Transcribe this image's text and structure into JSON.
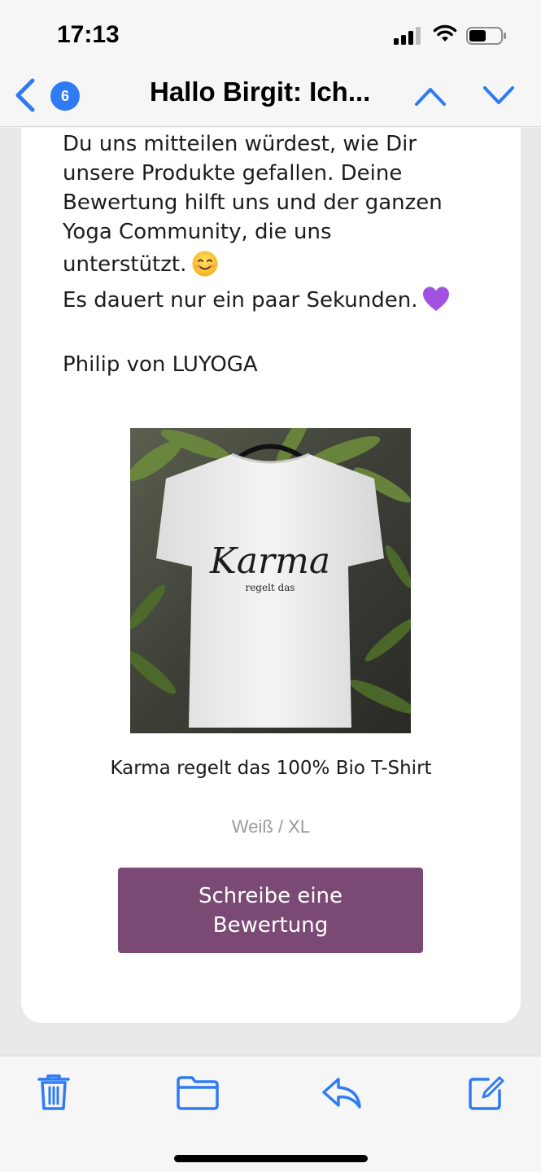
{
  "status_bar": {
    "time": "17:13"
  },
  "nav": {
    "back_icon": "chevron-left-icon",
    "unread_count": "6",
    "title": "Hallo Birgit: Ich...",
    "prev_icon": "chevron-up-icon",
    "next_icon": "chevron-down-icon"
  },
  "email": {
    "paragraph1_lines": [
      "Du uns mitteilen würdest, wie Dir",
      "unsere Produkte gefallen. Deine",
      "Bewertung hilft uns und der ganzen",
      "Yoga Community, die uns",
      "unterstützt."
    ],
    "paragraph1_emoji": "😊",
    "paragraph2": "Es dauert nur ein paar Sekunden.",
    "paragraph2_emoji": "💜",
    "signature": "Philip von LUYOGA",
    "product": {
      "image_print_title": "Karma",
      "image_print_subtitle": "regelt das",
      "name": "Karma regelt das 100% Bio T-Shirt",
      "variant": "Weiß / XL"
    },
    "review_button": "Schreibe eine Bewertung"
  },
  "toolbar": {
    "icons": [
      "trash-icon",
      "folder-icon",
      "reply-icon",
      "compose-icon"
    ]
  },
  "colors": {
    "ios_blue": "#2f7bf6",
    "button_purple": "#7a4a74",
    "variant_gray": "#9a9a9a"
  }
}
